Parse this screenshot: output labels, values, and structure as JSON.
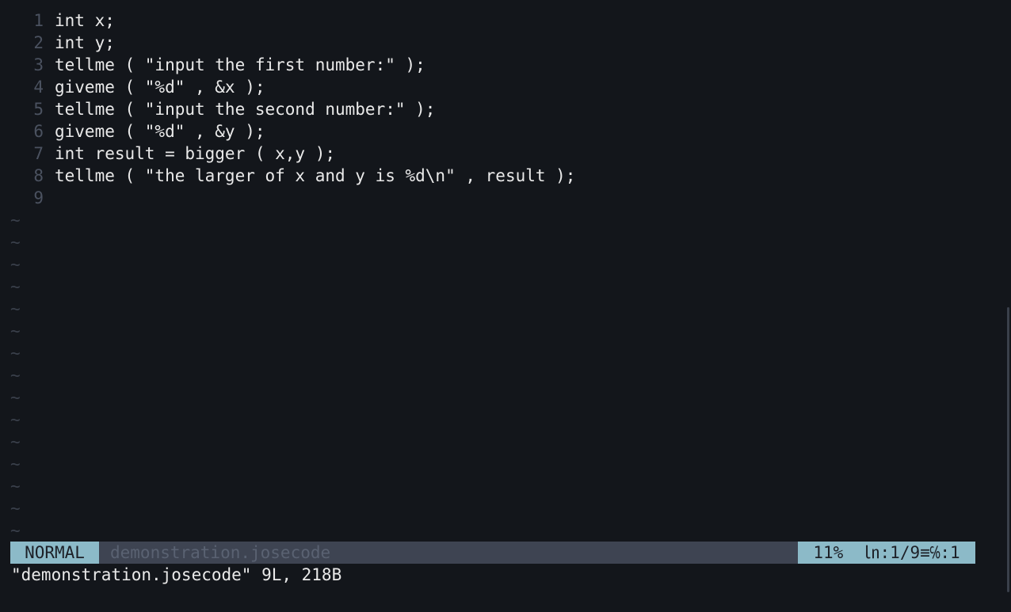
{
  "editor": {
    "lines": [
      {
        "number": "1",
        "text": "int x;"
      },
      {
        "number": "2",
        "text": "int y;"
      },
      {
        "number": "3",
        "text": "tellme ( \"input the first number:\" );"
      },
      {
        "number": "4",
        "text": "giveme ( \"%d\" , &x );"
      },
      {
        "number": "5",
        "text": "tellme ( \"input the second number:\" );"
      },
      {
        "number": "6",
        "text": "giveme ( \"%d\" , &y );"
      },
      {
        "number": "7",
        "text": "int result = bigger ( x,y );"
      },
      {
        "number": "8",
        "text": "tellme ( \"the larger of x and y is %d\\n\" , result );"
      },
      {
        "number": "9",
        "text": ""
      }
    ],
    "empty_line_marker": "~"
  },
  "statusline": {
    "mode": "NORMAL",
    "filename": "demonstration.josecode",
    "info": "11%  ㏑:1/9≡℅:1"
  },
  "cmdline": {
    "message": "\"demonstration.josecode\" 9L, 218B"
  },
  "colors": {
    "background": "#13161b",
    "accent": "#8cbac8",
    "statusline_bg": "#3e4452"
  }
}
